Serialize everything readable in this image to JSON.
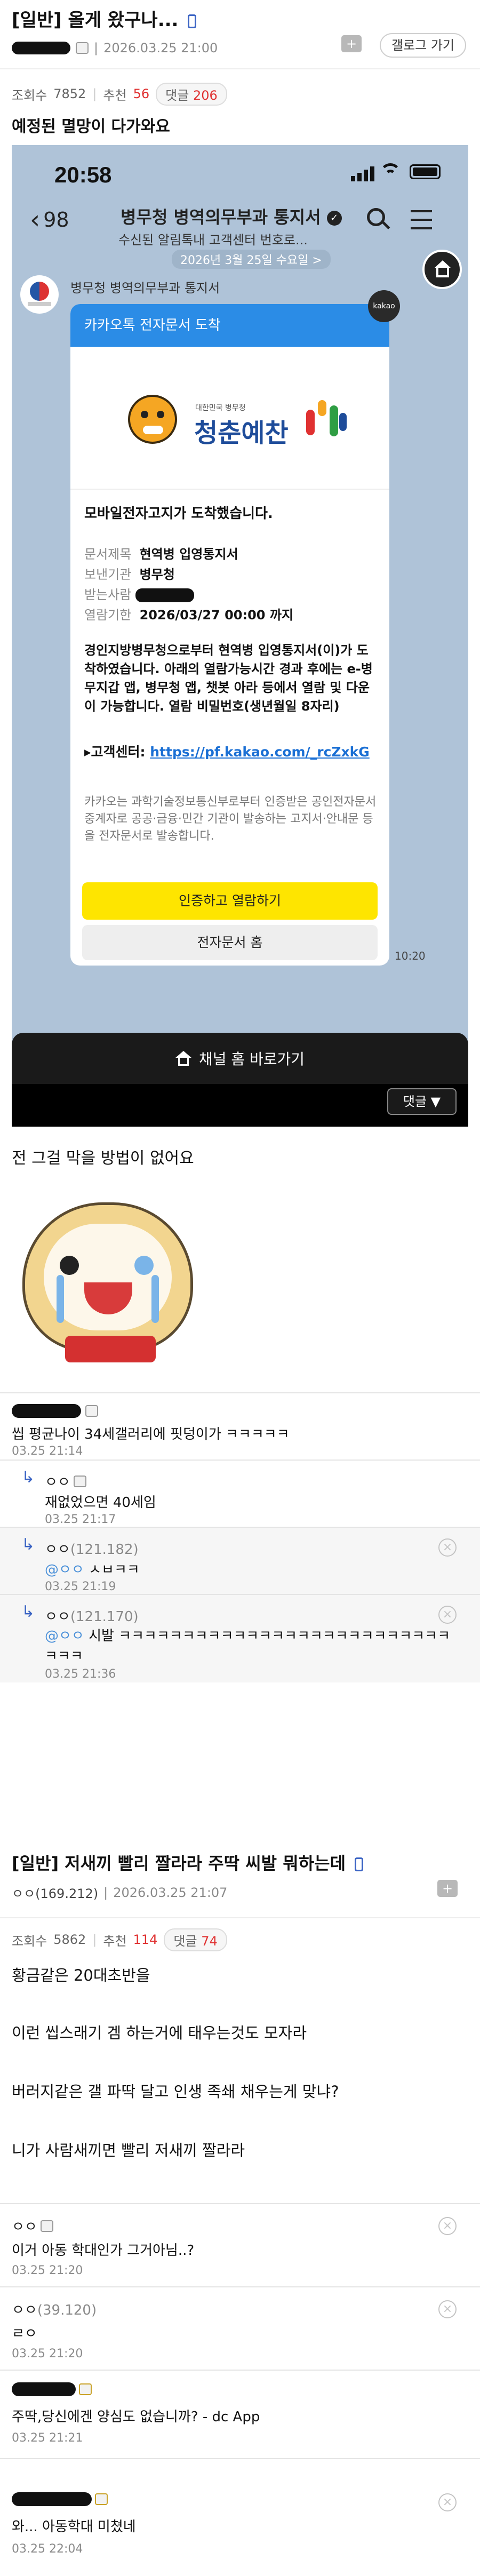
{
  "post1": {
    "title": "[일반] 올게 왔구나...",
    "title_icon": "mobile-icon",
    "date": "2026.03.25 21:00",
    "gallery_button": "갤로그 가기",
    "views_label": "조회수",
    "views": "7852",
    "recommend_label": "추천",
    "recommend": "56",
    "comments_label": "댓글",
    "comments": "206",
    "headline": "예정된 멸망이 다가와요",
    "body_text": "전 그걸 막을 방법이 없어요",
    "comment_toggle": "댓글 ▼"
  },
  "phone": {
    "time": "20:58",
    "back_count": "98",
    "channel_title": "병무청 병역의무부과 통지서",
    "channel_sub": "수신된 알림톡내 고객센터 번호로...",
    "date_pill": "2026년 3월 25일 수요일 >",
    "sender_name": "병무청 병역의무부과 통지서",
    "card_header": "카카오톡 전자문서 도착",
    "logo_org": "대한민국 병무청",
    "logo_text": "청춘예찬",
    "arrival": "모바일전자고지가 도착했습니다.",
    "doc_title_label": "문서제목",
    "doc_title": "현역병 입영통지서",
    "sender_label": "보낸기관",
    "sender": "병무청",
    "receiver_label": "받는사람",
    "deadline_label": "열람기한",
    "deadline": "2026/03/27 00:00 까지",
    "notice": "경인지방병무청으로부터 현역병 입영통지서(이)가 도착하였습니다. 아래의 열람가능시간 경과 후에는 e-병무지갑 앱, 병무청 앱, 챗봇 아라 등에서 열람 및 다운이 가능합니다. 열람 비밀번호(생년월일 8자리)",
    "service_label": "▸고객센터:",
    "service_link": "https://pf.kakao.com/_rcZxkG",
    "kakao_note": "카카오는 과학기술정보통신부로부터 인증받은 공인전자문서중계자로 공공·금융·민간 기관이 발송하는 고지서·안내문 등을 전자문서로 발송합니다.",
    "btn_verify": "인증하고 열람하기",
    "btn_home": "전자문서 홈",
    "msg_time": "10:20",
    "kakao_badge": "kakao",
    "channel_home": "채널 홈 바로가기"
  },
  "comments1": [
    {
      "author": "",
      "text": "씹 평균나이 34세갤러리에 핏덩이가 ㅋㅋㅋㅋㅋ",
      "date": "03.25 21:14",
      "reply": false
    },
    {
      "author": "ㅇㅇ",
      "ip": "",
      "text": "재없었으면 40세임",
      "date": "03.25 21:17",
      "reply": true
    },
    {
      "author": "ㅇㅇ",
      "ip": "(121.182)",
      "mention": "@ㅇㅇ",
      "text": "ㅅㅂㅋㅋ",
      "date": "03.25 21:19",
      "reply": true
    },
    {
      "author": "ㅇㅇ",
      "ip": "(121.170)",
      "mention": "@ㅇㅇ",
      "text": "시발 ㅋㅋㅋㅋㅋㅋㅋㅋㅋㅋㅋㅋㅋㅋㅋㅋㅋㅋㅋㅋㅋㅋㅋㅋㅋㅋㅋㅋㅋ",
      "date": "03.25 21:36",
      "reply": true
    }
  ],
  "post2": {
    "title": "[일반] 저새끼 빨리 짤라라 주딱 씨발 뭐하는데",
    "author": "ㅇㅇ(169.212)",
    "date": "2026.03.25 21:07",
    "views_label": "조회수",
    "views": "5862",
    "recommend_label": "추천",
    "recommend": "114",
    "comments_label": "댓글",
    "comments": "74",
    "lines": [
      "황금같은 20대초반을",
      "이런 씹스래기 겜 하는거에 태우는것도 모자라",
      "버러지같은 갤 파딱 달고 인생 족쇄 채우는게 맞냐?",
      "니가 사람새끼면 빨리 저새끼 짤라라"
    ]
  },
  "comments2": [
    {
      "author": "ㅇㅇ",
      "ip": "",
      "text": "이거 아동 학대인가 그거아님..?",
      "date": "03.25 21:20"
    },
    {
      "author": "ㅇㅇ",
      "ip": "(39.120)",
      "text": "ㄹㅇ",
      "date": "03.25 21:20"
    },
    {
      "author": "",
      "text": "주딱,당신에겐 양심도 없습니까? - dc App",
      "date": "03.25 21:21"
    },
    {
      "author": "",
      "text": "와... 아동학대 미쳤네",
      "date": "03.25 22:04"
    }
  ],
  "colors": {
    "red": "#e03131",
    "kakao_yellow": "#fee500",
    "kakao_blue": "#2b8ce6",
    "link_blue": "#1a6fd4",
    "mention_blue": "#4a90d9"
  }
}
